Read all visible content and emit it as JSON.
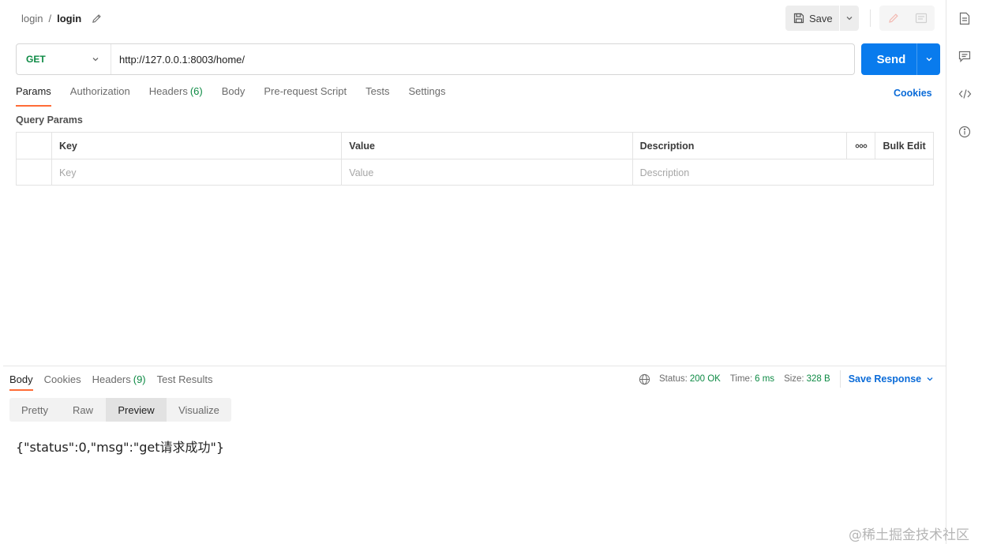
{
  "header": {
    "breadcrumb_parent": "login",
    "breadcrumb_separator": "/",
    "breadcrumb_current": "login",
    "save_label": "Save"
  },
  "request": {
    "method": "GET",
    "url": "http://127.0.0.1:8003/home/",
    "send_label": "Send"
  },
  "request_tabs": [
    {
      "label": "Params",
      "active": true
    },
    {
      "label": "Authorization"
    },
    {
      "label": "Headers",
      "count": "(6)"
    },
    {
      "label": "Body"
    },
    {
      "label": "Pre-request Script"
    },
    {
      "label": "Tests"
    },
    {
      "label": "Settings"
    }
  ],
  "cookies_label": "Cookies",
  "query_params": {
    "title": "Query Params",
    "columns": [
      "Key",
      "Value",
      "Description"
    ],
    "bulk_edit_label": "Bulk Edit",
    "more_label": "ooo",
    "placeholders": [
      "Key",
      "Value",
      "Description"
    ]
  },
  "response": {
    "tabs": [
      {
        "label": "Body",
        "active": true
      },
      {
        "label": "Cookies"
      },
      {
        "label": "Headers",
        "count": "(9)"
      },
      {
        "label": "Test Results"
      }
    ],
    "status_label": "Status:",
    "status_value": "200 OK",
    "time_label": "Time:",
    "time_value": "6 ms",
    "size_label": "Size:",
    "size_value": "328 B",
    "save_response_label": "Save Response",
    "views": [
      "Pretty",
      "Raw",
      "Preview",
      "Visualize"
    ],
    "active_view": "Preview",
    "body_text": "{\"status\":0,\"msg\":\"get请求成功\"}"
  },
  "watermark": "@稀土掘金技术社区",
  "colors": {
    "accent": "#097bed",
    "tab_indicator": "#ff6c37",
    "success": "#0d8a44",
    "link": "#0a6bd8",
    "method_get": "#0d8a44"
  }
}
